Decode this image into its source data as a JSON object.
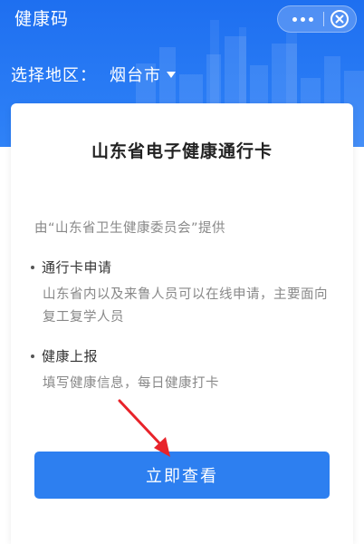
{
  "app": {
    "title": "健康码"
  },
  "capsule": {
    "more_icon": "more-dots-icon",
    "close_icon": "close-circle-icon"
  },
  "region": {
    "label": "选择地区：",
    "value": "烟台市"
  },
  "card": {
    "title": "山东省电子健康通行卡",
    "provider": "由“山东省卫生健康委员会”提供",
    "features": [
      {
        "title": "通行卡申请",
        "desc": "山东省内以及来鲁人员可以在线申请，主要面向复工复学人员"
      },
      {
        "title": "健康上报",
        "desc": "填写健康信息，每日健康打卡"
      }
    ],
    "button_label": "立即查看"
  },
  "colors": {
    "brand_blue": "#1e6ff0",
    "button_blue": "#2d7ff0",
    "annotation_red": "#e8232a"
  }
}
